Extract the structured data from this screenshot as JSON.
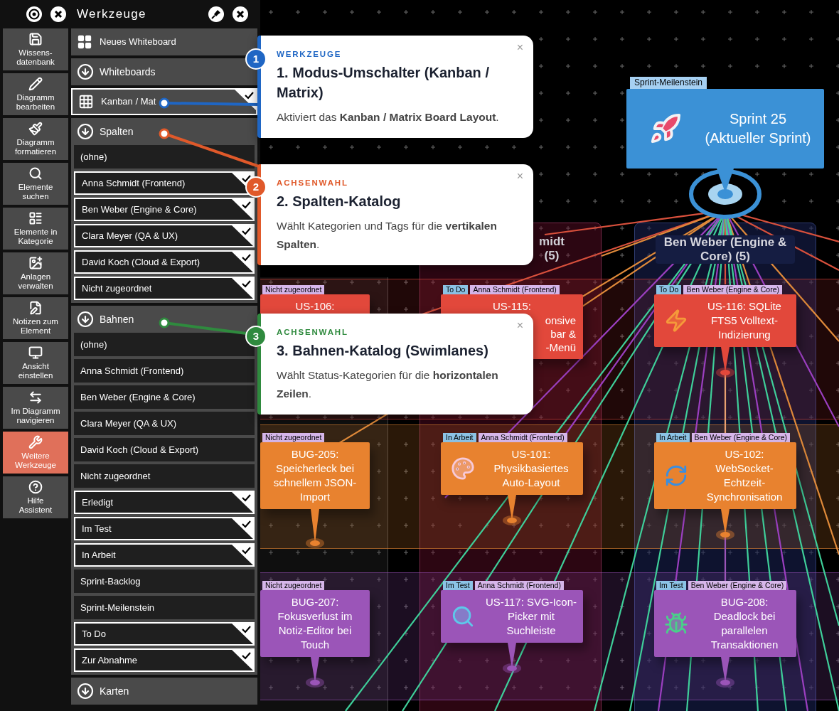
{
  "toolbar": {
    "title": "Werkzeuge"
  },
  "nav_buttons": [
    {
      "label": "Wissens-\ndatenbank",
      "selected": false
    },
    {
      "label": "Diagramm\nbearbeiten",
      "selected": false
    },
    {
      "label": "Diagramm\nformatieren",
      "selected": false
    },
    {
      "label": "Elemente\nsuchen",
      "selected": false
    },
    {
      "label": "Elemente in\nKategorie",
      "selected": false
    },
    {
      "label": "Anlagen\nverwalten",
      "selected": false
    },
    {
      "label": "Notizen zum\nElement",
      "selected": false
    },
    {
      "label": "Ansicht\neinstellen",
      "selected": false
    },
    {
      "label": "Im Diagramm\nnavigieren",
      "selected": false
    },
    {
      "label": "Weitere\nWerkzeuge",
      "selected": true
    },
    {
      "label": "Hilfe\nAssistent",
      "selected": false
    }
  ],
  "panel": [
    {
      "kind": "action",
      "label": "Neues Whiteboard"
    },
    {
      "kind": "section",
      "label": "Whiteboards"
    },
    {
      "kind": "toggle",
      "label": "Kanban / Mat",
      "checked": true
    },
    {
      "kind": "section",
      "label": "Spalten",
      "children": [
        {
          "label": "(ohne)",
          "checked": false
        },
        {
          "label": "Anna Schmidt (Frontend)",
          "checked": true
        },
        {
          "label": "Ben Weber (Engine & Core)",
          "checked": true
        },
        {
          "label": "Clara Meyer (QA & UX)",
          "checked": true
        },
        {
          "label": "David Koch (Cloud & Export)",
          "checked": true
        },
        {
          "label": "Nicht zugeordnet",
          "checked": true
        }
      ]
    },
    {
      "kind": "section",
      "label": "Bahnen",
      "children": [
        {
          "label": "(ohne)",
          "checked": false
        },
        {
          "label": "Anna Schmidt (Frontend)",
          "checked": false
        },
        {
          "label": "Ben Weber (Engine & Core)",
          "checked": false
        },
        {
          "label": "Clara Meyer (QA & UX)",
          "checked": false
        },
        {
          "label": "David Koch (Cloud & Export)",
          "checked": false
        },
        {
          "label": "Nicht zugeordnet",
          "checked": false
        },
        {
          "label": "Erledigt",
          "checked": true
        },
        {
          "label": "Im Test",
          "checked": true
        },
        {
          "label": "In Arbeit",
          "checked": true
        },
        {
          "label": "Sprint-Backlog",
          "checked": false
        },
        {
          "label": "Sprint-Meilenstein",
          "checked": false
        },
        {
          "label": "To Do",
          "checked": true
        },
        {
          "label": "Zur Abnahme",
          "checked": true
        }
      ]
    },
    {
      "kind": "section",
      "label": "Karten"
    }
  ],
  "callouts": [
    {
      "number": "1",
      "color": "#1f66c4",
      "category": "WERKZEUGE",
      "title": "1. Modus-Umschalter (Kanban / Matrix)",
      "text": "Aktiviert das **Kanban / Matrix Board Layout**.",
      "close": "×"
    },
    {
      "number": "2",
      "color": "#e0592a",
      "category": "ACHSENWAHL",
      "title": "2. Spalten-Katalog",
      "text": "Wählt Kategorien und Tags für die **vertikalen Spalten**.",
      "close": "×"
    },
    {
      "number": "3",
      "color": "#2f8a3e",
      "category": "ACHSENWAHL",
      "title": "3. Bahnen-Katalog (Swimlanes)",
      "text": "Wählt Status-Kategorien für die **horizontalen Zeilen**.",
      "close": "×"
    }
  ],
  "board": {
    "milestone": {
      "tag": "Sprint-Meilenstein",
      "title": "Sprint 25 (Aktueller Sprint)"
    },
    "columns": [
      {
        "header": "midt (5)"
      },
      {
        "header": "Ben Weber (Engine & Core) (5)"
      }
    ],
    "lanes": [
      {
        "color": "#e2483b",
        "cards": [
          {
            "tags": [
              {
                "kind": "assignee",
                "text": "Nicht zugeordnet"
              }
            ],
            "title": "US-106:"
          },
          {
            "tags": [
              {
                "kind": "status",
                "text": "To Do"
              },
              {
                "kind": "assignee",
                "text": "Anna Schmidt (Frontend)"
              }
            ],
            "title": "US-115:",
            "fragments": [
              "onsive",
              "bar &",
              "-Menü"
            ]
          },
          {
            "tags": [
              {
                "kind": "status",
                "text": "To Do"
              },
              {
                "kind": "assignee",
                "text": "Ben Weber (Engine & Core)"
              }
            ],
            "title": "US-116: SQLite FTS5 Volltext-Indizierung"
          }
        ]
      },
      {
        "color": "#e8822f",
        "cards": [
          {
            "tags": [
              {
                "kind": "assignee",
                "text": "Nicht zugeordnet"
              }
            ],
            "title": "BUG-205: Speicherleck bei schnellem JSON-Import"
          },
          {
            "tags": [
              {
                "kind": "status",
                "text": "In Arbeit"
              },
              {
                "kind": "assignee",
                "text": "Anna Schmidt (Frontend)"
              }
            ],
            "title": "US-101: Physikbasiertes Auto-Layout"
          },
          {
            "tags": [
              {
                "kind": "status",
                "text": "In Arbeit"
              },
              {
                "kind": "assignee",
                "text": "Ben Weber (Engine & Core)"
              }
            ],
            "title": "US-102: WebSocket-Echtzeit-Synchronisation"
          }
        ]
      },
      {
        "color": "#9b55b8",
        "cards": [
          {
            "tags": [
              {
                "kind": "assignee",
                "text": "Nicht zugeordnet"
              }
            ],
            "title": "BUG-207: Fokusverlust im Notiz-Editor bei Touch"
          },
          {
            "tags": [
              {
                "kind": "status",
                "text": "Im Test"
              },
              {
                "kind": "assignee",
                "text": "Anna Schmidt (Frontend)"
              }
            ],
            "title": "US-117: SVG-Icon-Picker mit Suchleiste"
          },
          {
            "tags": [
              {
                "kind": "status",
                "text": "Im Test"
              },
              {
                "kind": "assignee",
                "text": "Ben Weber (Engine & Core)"
              }
            ],
            "title": "BUG-208: Deadlock bei parallelen Transaktionen"
          }
        ]
      }
    ]
  }
}
